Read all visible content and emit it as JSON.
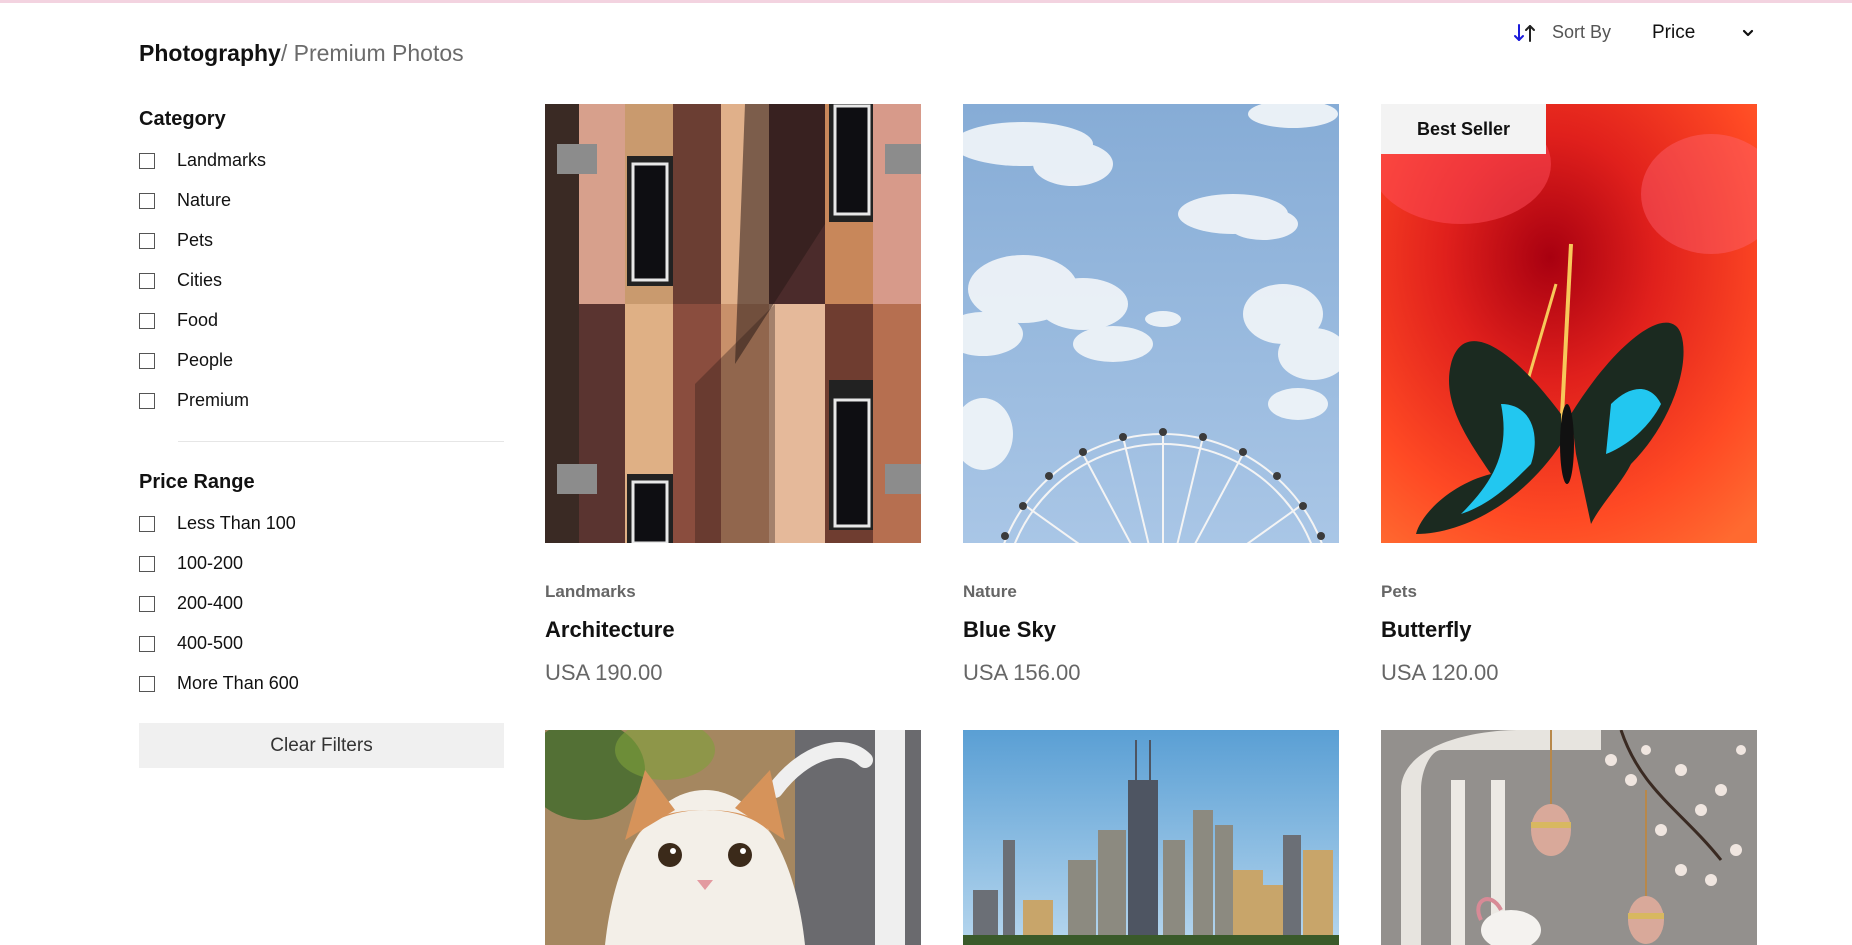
{
  "breadcrumb": {
    "main": "Photography",
    "separator": "/ ",
    "sub": "Premium Photos"
  },
  "sort": {
    "icon": "sort-arrows-icon",
    "label": "Sort By",
    "value": "Price",
    "chevron": "chevron-down-icon",
    "icon_color": "#1a1adb"
  },
  "filters": {
    "category": {
      "title": "Category",
      "items": [
        "Landmarks",
        "Nature",
        "Pets",
        "Cities",
        "Food",
        "People",
        "Premium"
      ]
    },
    "price_range": {
      "title": "Price Range",
      "items": [
        "Less Than 100",
        "100-200",
        "200-400",
        "400-500",
        "More Than 600"
      ]
    },
    "clear_label": "Clear Filters"
  },
  "products": [
    {
      "category": "Landmarks",
      "title": "Architecture",
      "price": "USA 190.00",
      "badge": ""
    },
    {
      "category": "Nature",
      "title": "Blue Sky",
      "price": "USA 156.00",
      "badge": ""
    },
    {
      "category": "Pets",
      "title": "Butterfly",
      "price": "USA 120.00",
      "badge": "Best Seller"
    }
  ],
  "colors": {
    "accent_line": "#f3d3e0",
    "muted_text": "#666666",
    "button_bg": "#f0f0f0"
  }
}
